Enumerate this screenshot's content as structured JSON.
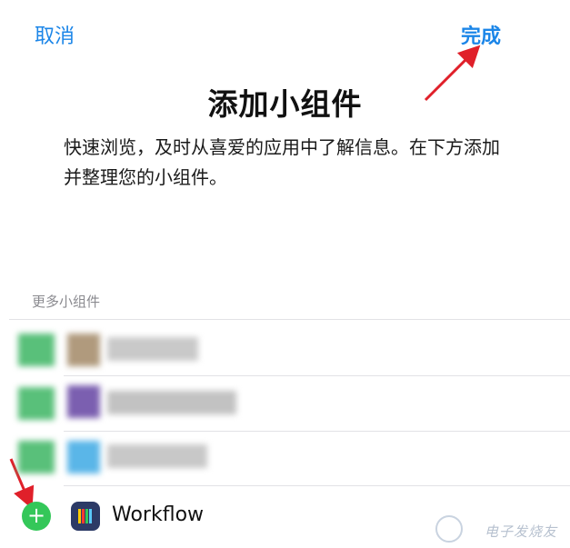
{
  "nav": {
    "cancel_label": "取消",
    "done_label": "完成"
  },
  "header": {
    "title": "添加小组件",
    "description": "快速浏览，及时从喜爱的应用中了解信息。在下方添加并整理您的小组件。"
  },
  "section": {
    "label": "更多小组件"
  },
  "widgets": [
    {
      "name": "",
      "blurred": true
    },
    {
      "name": "",
      "blurred": true
    },
    {
      "name": "",
      "blurred": true
    },
    {
      "name": "Workflow",
      "blurred": false
    }
  ],
  "watermark": {
    "text": "电子发烧友"
  },
  "colors": {
    "accent": "#1c86e8",
    "add_green": "#34c759",
    "arrow_red": "#e0202a"
  }
}
